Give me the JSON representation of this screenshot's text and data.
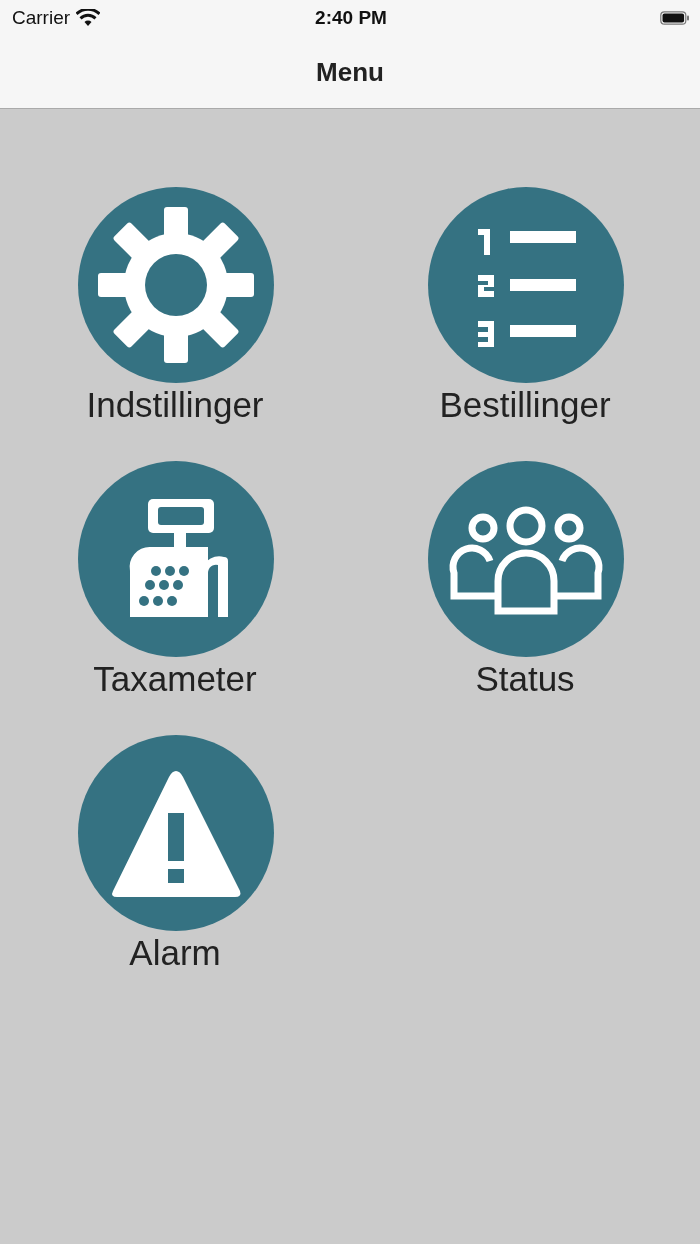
{
  "status_bar": {
    "carrier": "Carrier",
    "time": "2:40 PM"
  },
  "nav_bar": {
    "title": "Menu"
  },
  "menu_items": [
    {
      "label": "Indstillinger",
      "kind": "gear"
    },
    {
      "label": "Bestillinger",
      "kind": "list"
    },
    {
      "label": "Taxameter",
      "kind": "register"
    },
    {
      "label": "Status",
      "kind": "people"
    },
    {
      "label": "Alarm",
      "kind": "warning"
    }
  ]
}
